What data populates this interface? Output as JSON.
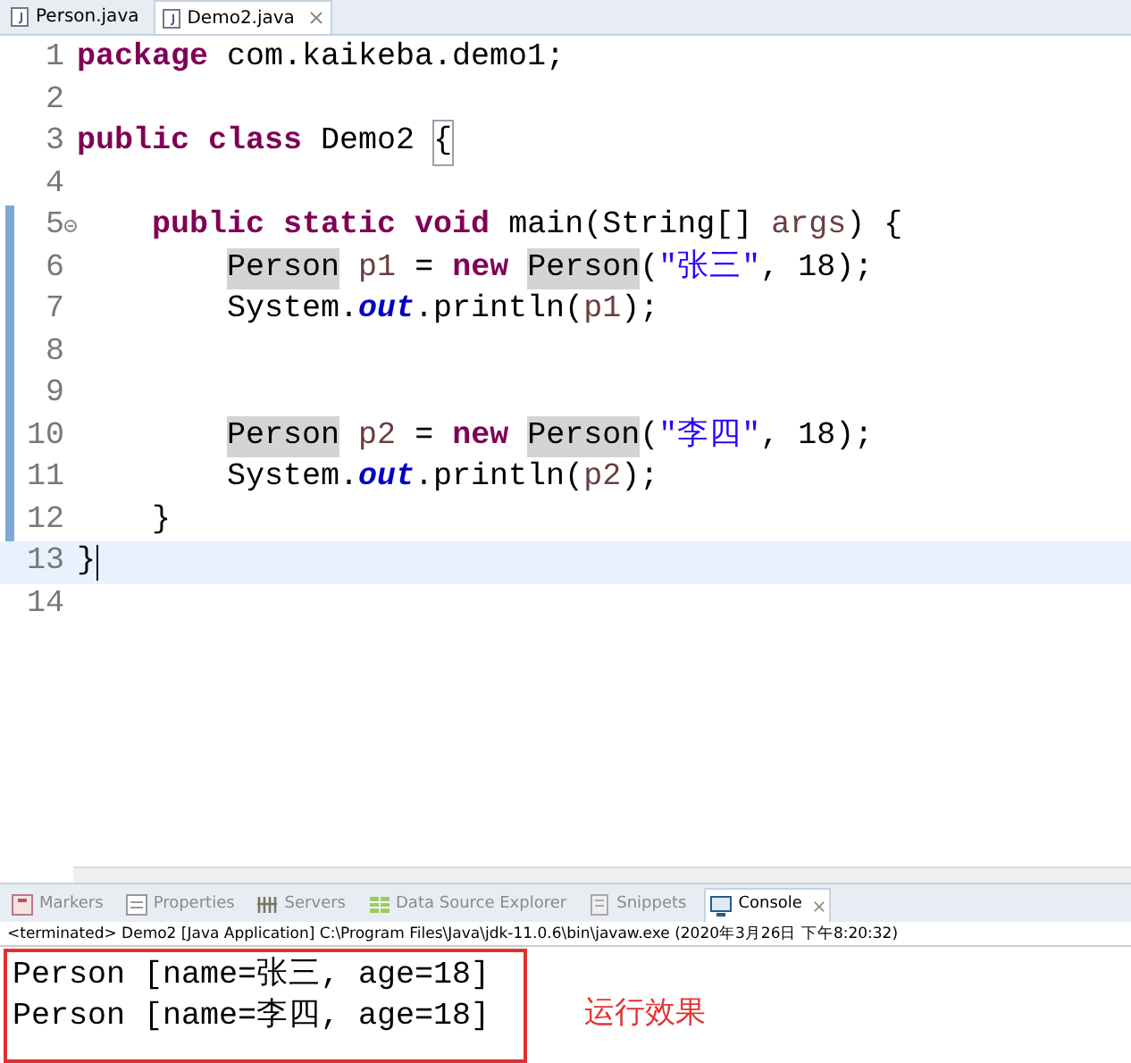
{
  "editor_tabs": [
    {
      "label": "Person.java",
      "selected": false
    },
    {
      "label": "Demo2.java",
      "selected": true
    }
  ],
  "code_lines": [
    {
      "number": "1",
      "changed": false,
      "current": false,
      "fold": false,
      "tokens": [
        {
          "kind": "kw",
          "text": "package"
        },
        {
          "kind": "plain",
          "text": " com.kaikeba.demo1;"
        }
      ]
    },
    {
      "number": "2",
      "changed": false,
      "current": false,
      "fold": false
    },
    {
      "number": "3",
      "changed": false,
      "current": false,
      "fold": false,
      "tokens": [
        {
          "kind": "kw",
          "text": "public class"
        },
        {
          "kind": "plain",
          "text": " Demo2 "
        },
        {
          "kind": "bracket",
          "text": "{"
        }
      ]
    },
    {
      "number": "4",
      "changed": false,
      "current": false,
      "fold": false
    },
    {
      "number": "5",
      "changed": true,
      "current": false,
      "fold": true,
      "tokens": [
        {
          "kind": "kw",
          "text": "    public static void"
        },
        {
          "kind": "plain",
          "text": " main(String[] "
        },
        {
          "kind": "var",
          "text": "args"
        },
        {
          "kind": "plain",
          "text": ") {"
        }
      ]
    },
    {
      "number": "6",
      "changed": true,
      "current": false,
      "fold": false,
      "tokens": [
        {
          "kind": "mark",
          "text": "        Person"
        },
        {
          "kind": "var",
          "text": " p1"
        },
        {
          "kind": "plain",
          "text": " = "
        },
        {
          "kind": "kw",
          "text": "new"
        },
        {
          "kind": "mark",
          "text": " Person"
        },
        {
          "kind": "plain",
          "text": "("
        },
        {
          "kind": "str",
          "text": "\"张三\""
        },
        {
          "kind": "plain",
          "text": ", 18);"
        }
      ]
    },
    {
      "number": "7",
      "changed": true,
      "current": false,
      "fold": false,
      "tokens": [
        {
          "kind": "plain",
          "text": "        System."
        },
        {
          "kind": "field",
          "text": "out"
        },
        {
          "kind": "plain",
          "text": ".println("
        },
        {
          "kind": "var",
          "text": "p1"
        },
        {
          "kind": "plain",
          "text": ");"
        }
      ]
    },
    {
      "number": "8",
      "changed": true,
      "current": false,
      "fold": false
    },
    {
      "number": "9",
      "changed": true,
      "current": false,
      "fold": false
    },
    {
      "number": "10",
      "changed": true,
      "current": false,
      "fold": false,
      "tokens": [
        {
          "kind": "mark",
          "text": "        Person"
        },
        {
          "kind": "var",
          "text": " p2"
        },
        {
          "kind": "plain",
          "text": " = "
        },
        {
          "kind": "kw",
          "text": "new"
        },
        {
          "kind": "mark",
          "text": " Person"
        },
        {
          "kind": "plain",
          "text": "("
        },
        {
          "kind": "str",
          "text": "\"李四\""
        },
        {
          "kind": "plain",
          "text": ", 18);"
        }
      ]
    },
    {
      "number": "11",
      "changed": true,
      "current": false,
      "fold": false,
      "tokens": [
        {
          "kind": "plain",
          "text": "        System."
        },
        {
          "kind": "field",
          "text": "out"
        },
        {
          "kind": "plain",
          "text": ".println("
        },
        {
          "kind": "var",
          "text": "p2"
        },
        {
          "kind": "plain",
          "text": ");"
        }
      ]
    },
    {
      "number": "12",
      "changed": true,
      "current": false,
      "fold": false,
      "tokens": [
        {
          "kind": "plain",
          "text": "    }"
        }
      ]
    },
    {
      "number": "13",
      "changed": false,
      "current": true,
      "fold": false,
      "tokens": [
        {
          "kind": "plain",
          "text": "}"
        }
      ]
    },
    {
      "number": "14",
      "changed": false,
      "current": false,
      "fold": false
    }
  ],
  "view_tabs": [
    {
      "label": "Markers",
      "selected": false,
      "kind": "markers"
    },
    {
      "label": "Properties",
      "selected": false,
      "kind": "properties"
    },
    {
      "label": "Servers",
      "selected": false,
      "kind": "servers"
    },
    {
      "label": "Data Source Explorer",
      "selected": false,
      "kind": "datasource"
    },
    {
      "label": "Snippets",
      "selected": false,
      "kind": "snippets"
    },
    {
      "label": "Console",
      "selected": true,
      "kind": "console"
    }
  ],
  "console": {
    "status": "<terminated> Demo2 [Java Application] C:\\Program Files\\Java\\jdk-11.0.6\\bin\\javaw.exe (2020年3月26日 下午8:20:32)",
    "output": [
      "Person [name=张三, age=18]",
      "Person [name=李四, age=18]"
    ],
    "annotation": "运行效果"
  }
}
